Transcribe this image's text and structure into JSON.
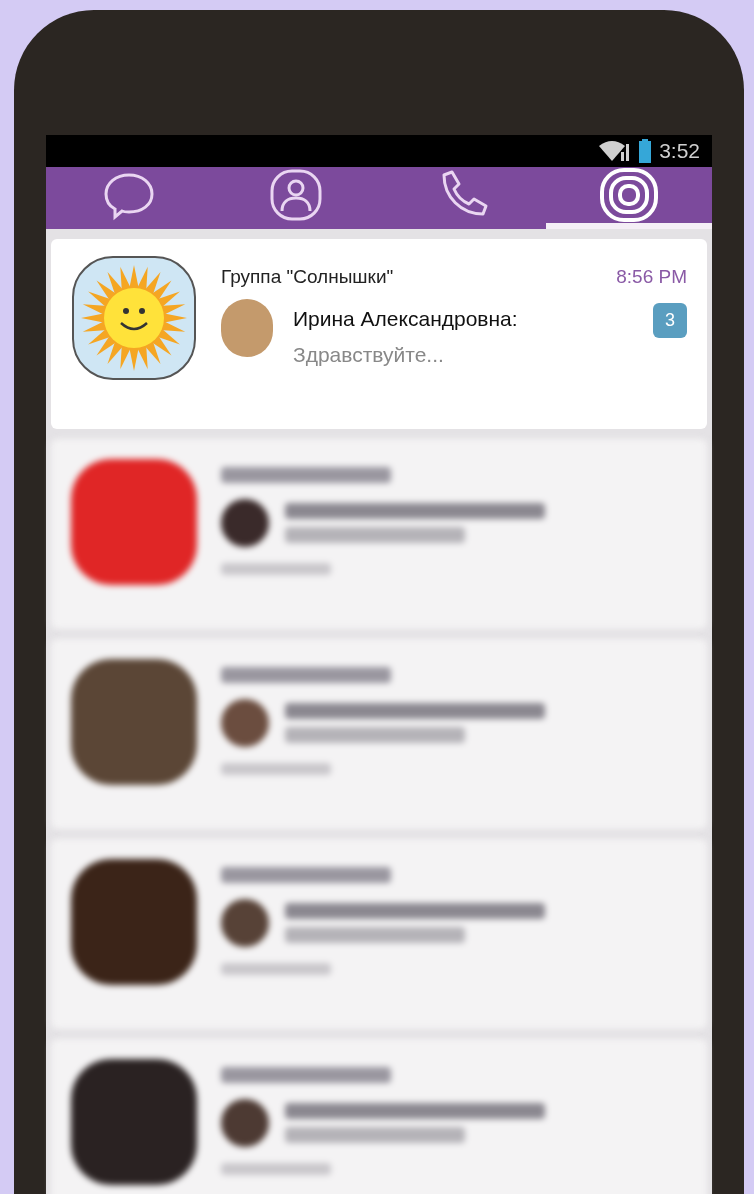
{
  "status_bar": {
    "time": "3:52"
  },
  "tabs": [
    {
      "kind": "chats",
      "selected": false
    },
    {
      "kind": "contacts",
      "selected": false
    },
    {
      "kind": "calls",
      "selected": false
    },
    {
      "kind": "public",
      "selected": true
    }
  ],
  "chats": [
    {
      "title": "Группа \"Солнышки\"",
      "time": "8:56 PM",
      "sender": "Ирина Александровна:",
      "message": "Здравствуйте...",
      "unread": "3"
    }
  ]
}
